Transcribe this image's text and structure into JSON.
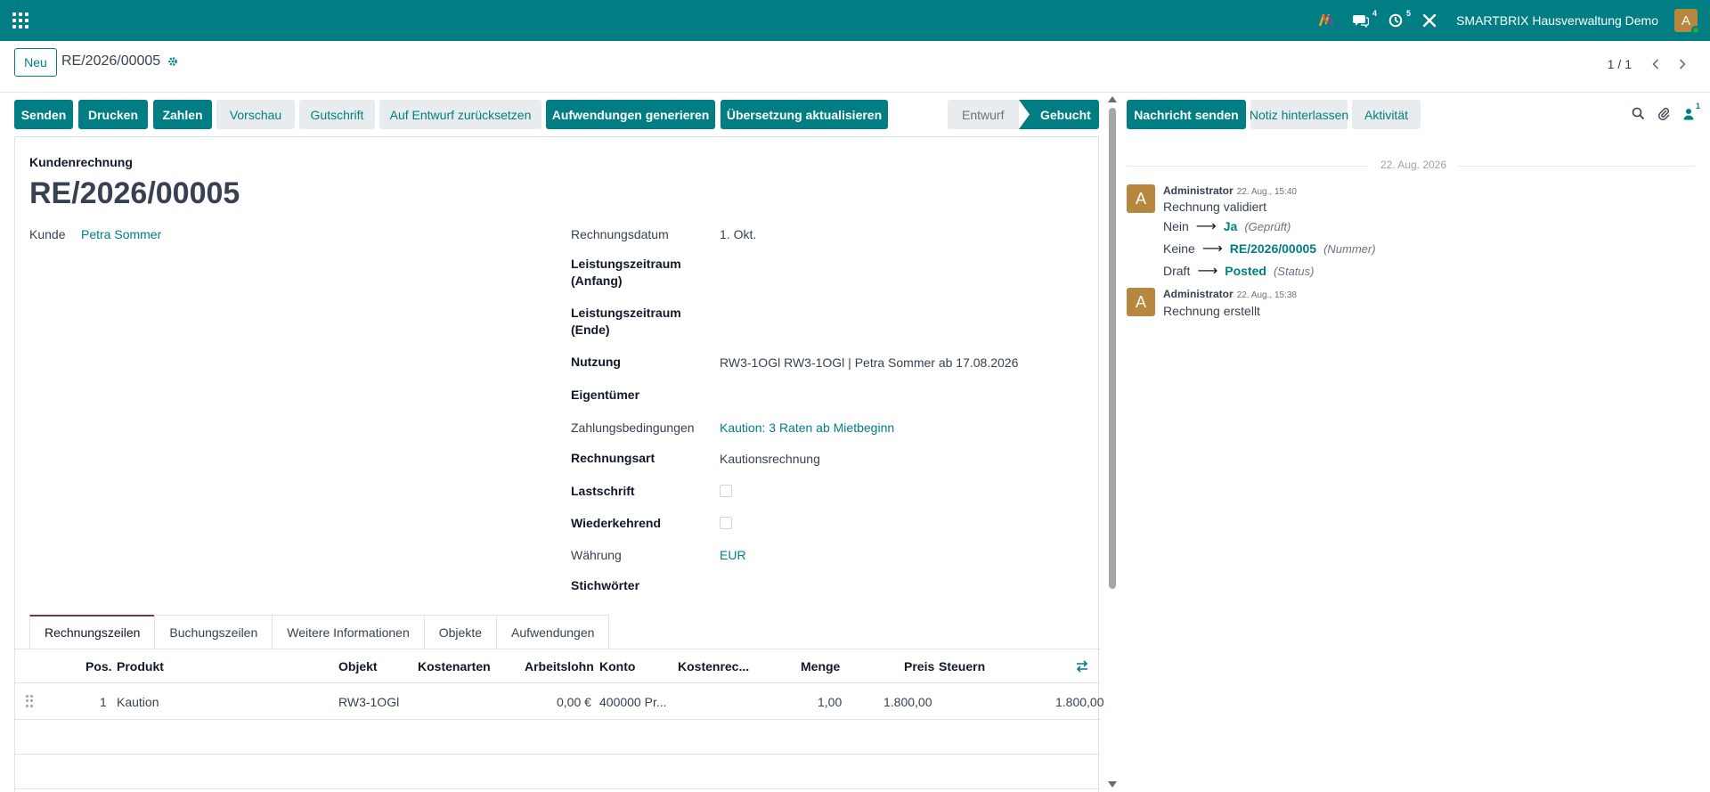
{
  "topbar": {
    "messages_count": "4",
    "activities_count": "5",
    "company": "SMARTBRIX Hausverwaltung Demo",
    "avatar_letter": "A",
    "colors": {
      "primary": "#017e84",
      "avatar": "#b7863f"
    }
  },
  "control": {
    "new_label": "Neu",
    "record_name": "RE/2026/00005",
    "pager": "1 / 1"
  },
  "statusbar": {
    "buttons": [
      "Senden",
      "Drucken",
      "Zahlen",
      "Vorschau",
      "Gutschrift",
      "Auf Entwurf zurücksetzen",
      "Aufwendungen generieren",
      "Übersetzung aktualisieren"
    ],
    "stages": [
      "Entwurf",
      "Gebucht"
    ],
    "active_stage": "Gebucht"
  },
  "form": {
    "doc_type": "Kundenrechnung",
    "name": "RE/2026/00005",
    "customer_label": "Kunde",
    "customer": "Petra Sommer",
    "invoice_date_label": "Rechnungsdatum",
    "invoice_date": "1. Okt.",
    "period_start_label_1": "Leistungszeitraum",
    "period_start_label_2": "(Anfang)",
    "period_end_label_1": "Leistungszeitraum",
    "period_end_label_2": "(Ende)",
    "usage_label": "Nutzung",
    "usage": "RW3-1OGl RW3-1OGl | Petra Sommer ab 17.08.2026",
    "owner_label": "Eigentümer",
    "payment_terms_label": "Zahlungsbedingungen",
    "payment_terms": "Kaution: 3 Raten ab Mietbeginn",
    "invoice_kind_label": "Rechnungsart",
    "invoice_kind": "Kautionsrechnung",
    "direct_debit_label": "Lastschrift",
    "recurring_label": "Wiederkehrend",
    "currency_label": "Währung",
    "currency": "EUR",
    "tags_label": "Stichwörter"
  },
  "tabs": [
    "Rechnungszeilen",
    "Buchungszeilen",
    "Weitere Informationen",
    "Objekte",
    "Aufwendungen"
  ],
  "table": {
    "headers": [
      "Pos.",
      "Produkt",
      "Objekt",
      "Kostenarten",
      "Arbeitslohn",
      "Konto",
      "Kostenrec...",
      "Menge",
      "Preis",
      "Steuern"
    ],
    "rows": [
      {
        "pos": "1",
        "product": "Kaution",
        "object": "RW3-1OGl",
        "cost_types": "",
        "labor": "0,00 €",
        "account": "400000 Pr...",
        "cost_center": "",
        "qty": "1,00",
        "price": "1.800,00",
        "taxes": "",
        "subtotal": "1.800,00"
      }
    ]
  },
  "chatter": {
    "send_message": "Nachricht senden",
    "log_note": "Notiz hinterlassen",
    "activity": "Aktivität",
    "followers_count": "1",
    "date_separator": "22. Aug. 2026",
    "messages": [
      {
        "avatar": "A",
        "author": "Administrator",
        "date": "22. Aug., 15:40",
        "body": "Rechnung validiert",
        "tracking": [
          {
            "old": "Nein",
            "new": "Ja",
            "field": "(Geprüft)"
          },
          {
            "old": "Keine",
            "new": "RE/2026/00005",
            "field": "(Nummer)"
          },
          {
            "old": "Draft",
            "new": "Posted",
            "field": "(Status)"
          }
        ]
      },
      {
        "avatar": "A",
        "author": "Administrator",
        "date": "22. Aug., 15:38",
        "body": "Rechnung erstellt"
      }
    ]
  }
}
